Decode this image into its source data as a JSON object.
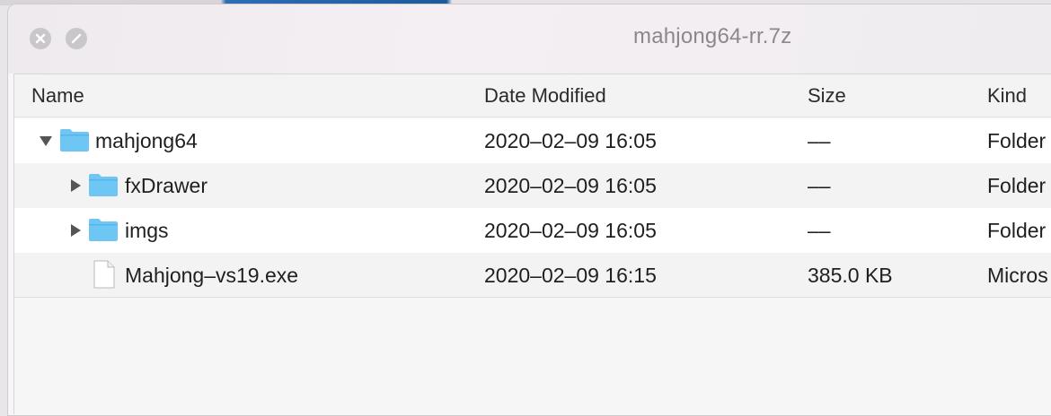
{
  "window": {
    "title": "mahjong64-rr.7z"
  },
  "columns": {
    "name": "Name",
    "date": "Date Modified",
    "size": "Size",
    "kind": "Kind"
  },
  "rows": [
    {
      "name": "mahjong64",
      "date": "2020–02–09 16:05",
      "size": "––",
      "kind": "Folder",
      "icon": "folder-icon",
      "expanded": true
    },
    {
      "name": "fxDrawer",
      "date": "2020–02–09 16:05",
      "size": "––",
      "kind": "Folder",
      "icon": "folder-icon",
      "expanded": false
    },
    {
      "name": "imgs",
      "date": "2020–02–09 16:05",
      "size": "––",
      "kind": "Folder",
      "icon": "folder-icon",
      "expanded": false
    },
    {
      "name": "Mahjong–vs19.exe",
      "date": "2020–02–09 16:15",
      "size": "385.0 KB",
      "kind": "Micros",
      "icon": "file-icon"
    }
  ],
  "colors": {
    "folder": "#6ec6f5",
    "traffic": "#c9c7cb",
    "title_text": "#8b878c"
  }
}
